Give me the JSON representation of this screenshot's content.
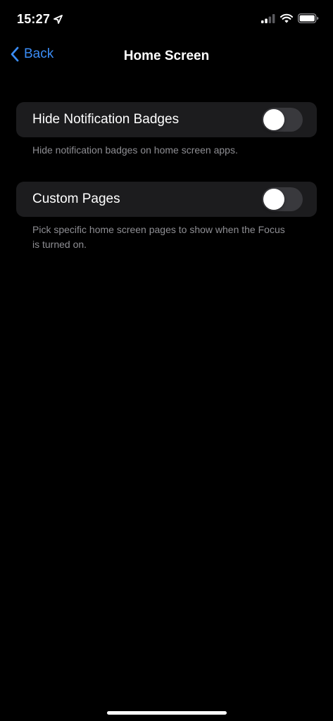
{
  "status_bar": {
    "time": "15:27",
    "icons": [
      "location-arrow-icon",
      "cellular-signal-icon",
      "wifi-icon",
      "battery-icon"
    ]
  },
  "nav": {
    "back_label": "Back",
    "title": "Home Screen",
    "accent_color": "#3a8cf5"
  },
  "settings": {
    "hide_badges": {
      "label": "Hide Notification Badges",
      "enabled": false,
      "description": "Hide notification badges on home screen apps."
    },
    "custom_pages": {
      "label": "Custom Pages",
      "enabled": false,
      "description": "Pick specific home screen pages to show when the Focus is turned on."
    }
  },
  "colors": {
    "background": "#000000",
    "cell_background": "#1c1c1e",
    "toggle_off": "#39393d",
    "secondary_text": "#8e8e93"
  }
}
